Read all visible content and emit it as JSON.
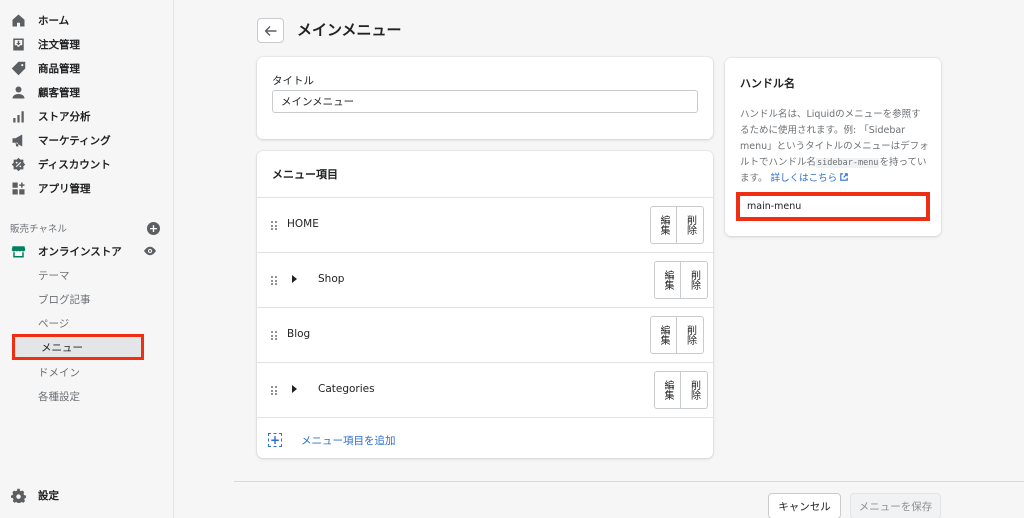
{
  "sidebar": {
    "items": [
      {
        "label": "ホーム",
        "icon": "home-icon"
      },
      {
        "label": "注文管理",
        "icon": "orders-icon"
      },
      {
        "label": "商品管理",
        "icon": "tag-icon"
      },
      {
        "label": "顧客管理",
        "icon": "person-icon"
      },
      {
        "label": "ストア分析",
        "icon": "analytics-icon"
      },
      {
        "label": "マーケティング",
        "icon": "megaphone-icon"
      },
      {
        "label": "ディスカウント",
        "icon": "discount-icon"
      },
      {
        "label": "アプリ管理",
        "icon": "apps-icon"
      }
    ],
    "channels_heading": "販売チャネル",
    "online_store": "オンラインストア",
    "sub_items": [
      "テーマ",
      "ブログ記事",
      "ページ",
      "メニュー",
      "ドメイン",
      "各種設定"
    ],
    "active_sub_item": "メニュー",
    "settings": "設定"
  },
  "header": {
    "title": "メインメニュー"
  },
  "title_card": {
    "label": "タイトル",
    "value": "メインメニュー"
  },
  "menu_card": {
    "title": "メニュー項目",
    "rows": [
      {
        "label": "HOME",
        "expandable": false,
        "edit": "編集",
        "delete": "削除"
      },
      {
        "label": "Shop",
        "expandable": true,
        "edit": "編集",
        "delete": "削除"
      },
      {
        "label": "Blog",
        "expandable": false,
        "edit": "編集",
        "delete": "削除"
      },
      {
        "label": "Categories",
        "expandable": true,
        "edit": "編集",
        "delete": "削除"
      }
    ],
    "add_label": "メニュー項目を追加"
  },
  "handle_card": {
    "title": "ハンドル名",
    "desc_part1": "ハンドル名は、Liquidのメニューを参照するために使用されます。例: 「Sidebar menu」というタイトルのメニューはデフォルトでハンドル名",
    "code": "sidebar-menu",
    "desc_part2": "を持っています。",
    "learn_more": "詳しくはこちら",
    "value": "main-menu"
  },
  "footer": {
    "cancel": "キャンセル",
    "save": "メニューを保存"
  },
  "colors": {
    "accent": "#2c6ecb",
    "highlight": "#ef2e14",
    "online_store_icon": "#008060"
  }
}
